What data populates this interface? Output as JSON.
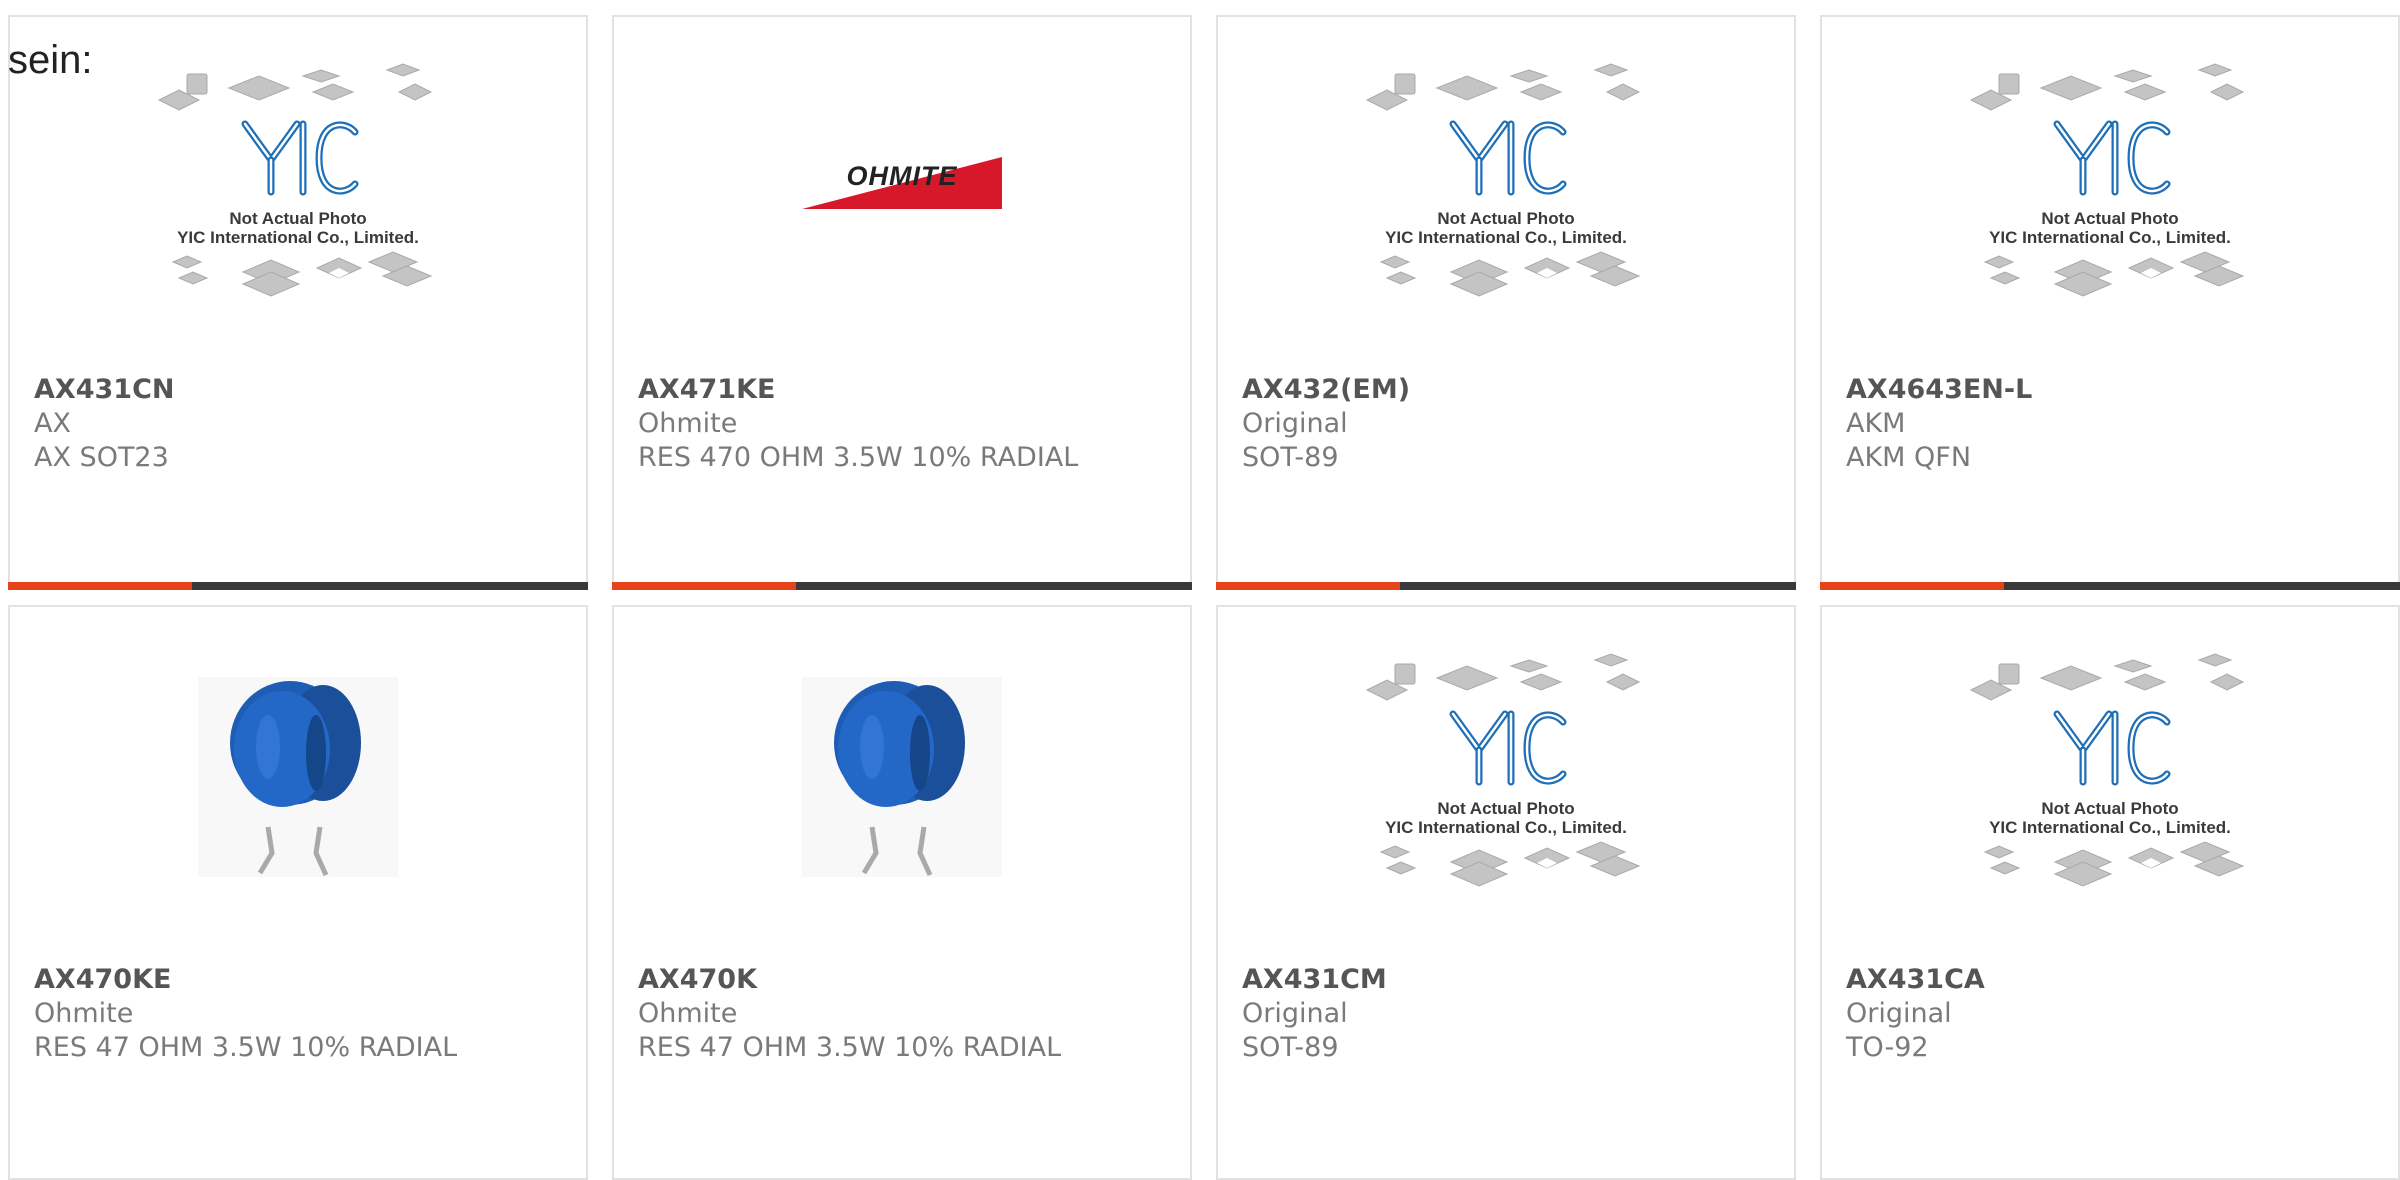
{
  "heading": "sein:",
  "placeholder": {
    "logo": "YIC",
    "caption_1": "Not Actual Photo",
    "caption_2": "YIC International Co., Limited."
  },
  "ohmite_logo": "OHMITE",
  "colors": {
    "accent": "#e8421a",
    "bar": "#3a3a3a",
    "yic_blue": "#1d6fb8",
    "ohmite_red": "#d7182a",
    "varistor_blue": "#1f5db5"
  },
  "products": [
    {
      "part_number": "AX431CN",
      "manufacturer": "AX",
      "description": "AX SOT23",
      "image": "placeholder-photo"
    },
    {
      "part_number": "AX471KE",
      "manufacturer": "Ohmite",
      "description": "RES 470 OHM 3.5W 10% RADIAL",
      "image": "ohmite-logo"
    },
    {
      "part_number": "AX432(EM)",
      "manufacturer": "Original",
      "description": "SOT-89",
      "image": "placeholder-photo"
    },
    {
      "part_number": "AX4643EN-L",
      "manufacturer": "AKM",
      "description": "AKM QFN",
      "image": "placeholder-photo"
    },
    {
      "part_number": "AX470KE",
      "manufacturer": "Ohmite",
      "description": "RES 47 OHM 3.5W 10% RADIAL",
      "image": "varistor-photo"
    },
    {
      "part_number": "AX470K",
      "manufacturer": "Ohmite",
      "description": "RES 47 OHM 3.5W 10% RADIAL",
      "image": "varistor-photo"
    },
    {
      "part_number": "AX431CM",
      "manufacturer": "Original",
      "description": "SOT-89",
      "image": "placeholder-photo"
    },
    {
      "part_number": "AX431CA",
      "manufacturer": "Original",
      "description": "TO-92",
      "image": "placeholder-photo"
    }
  ]
}
